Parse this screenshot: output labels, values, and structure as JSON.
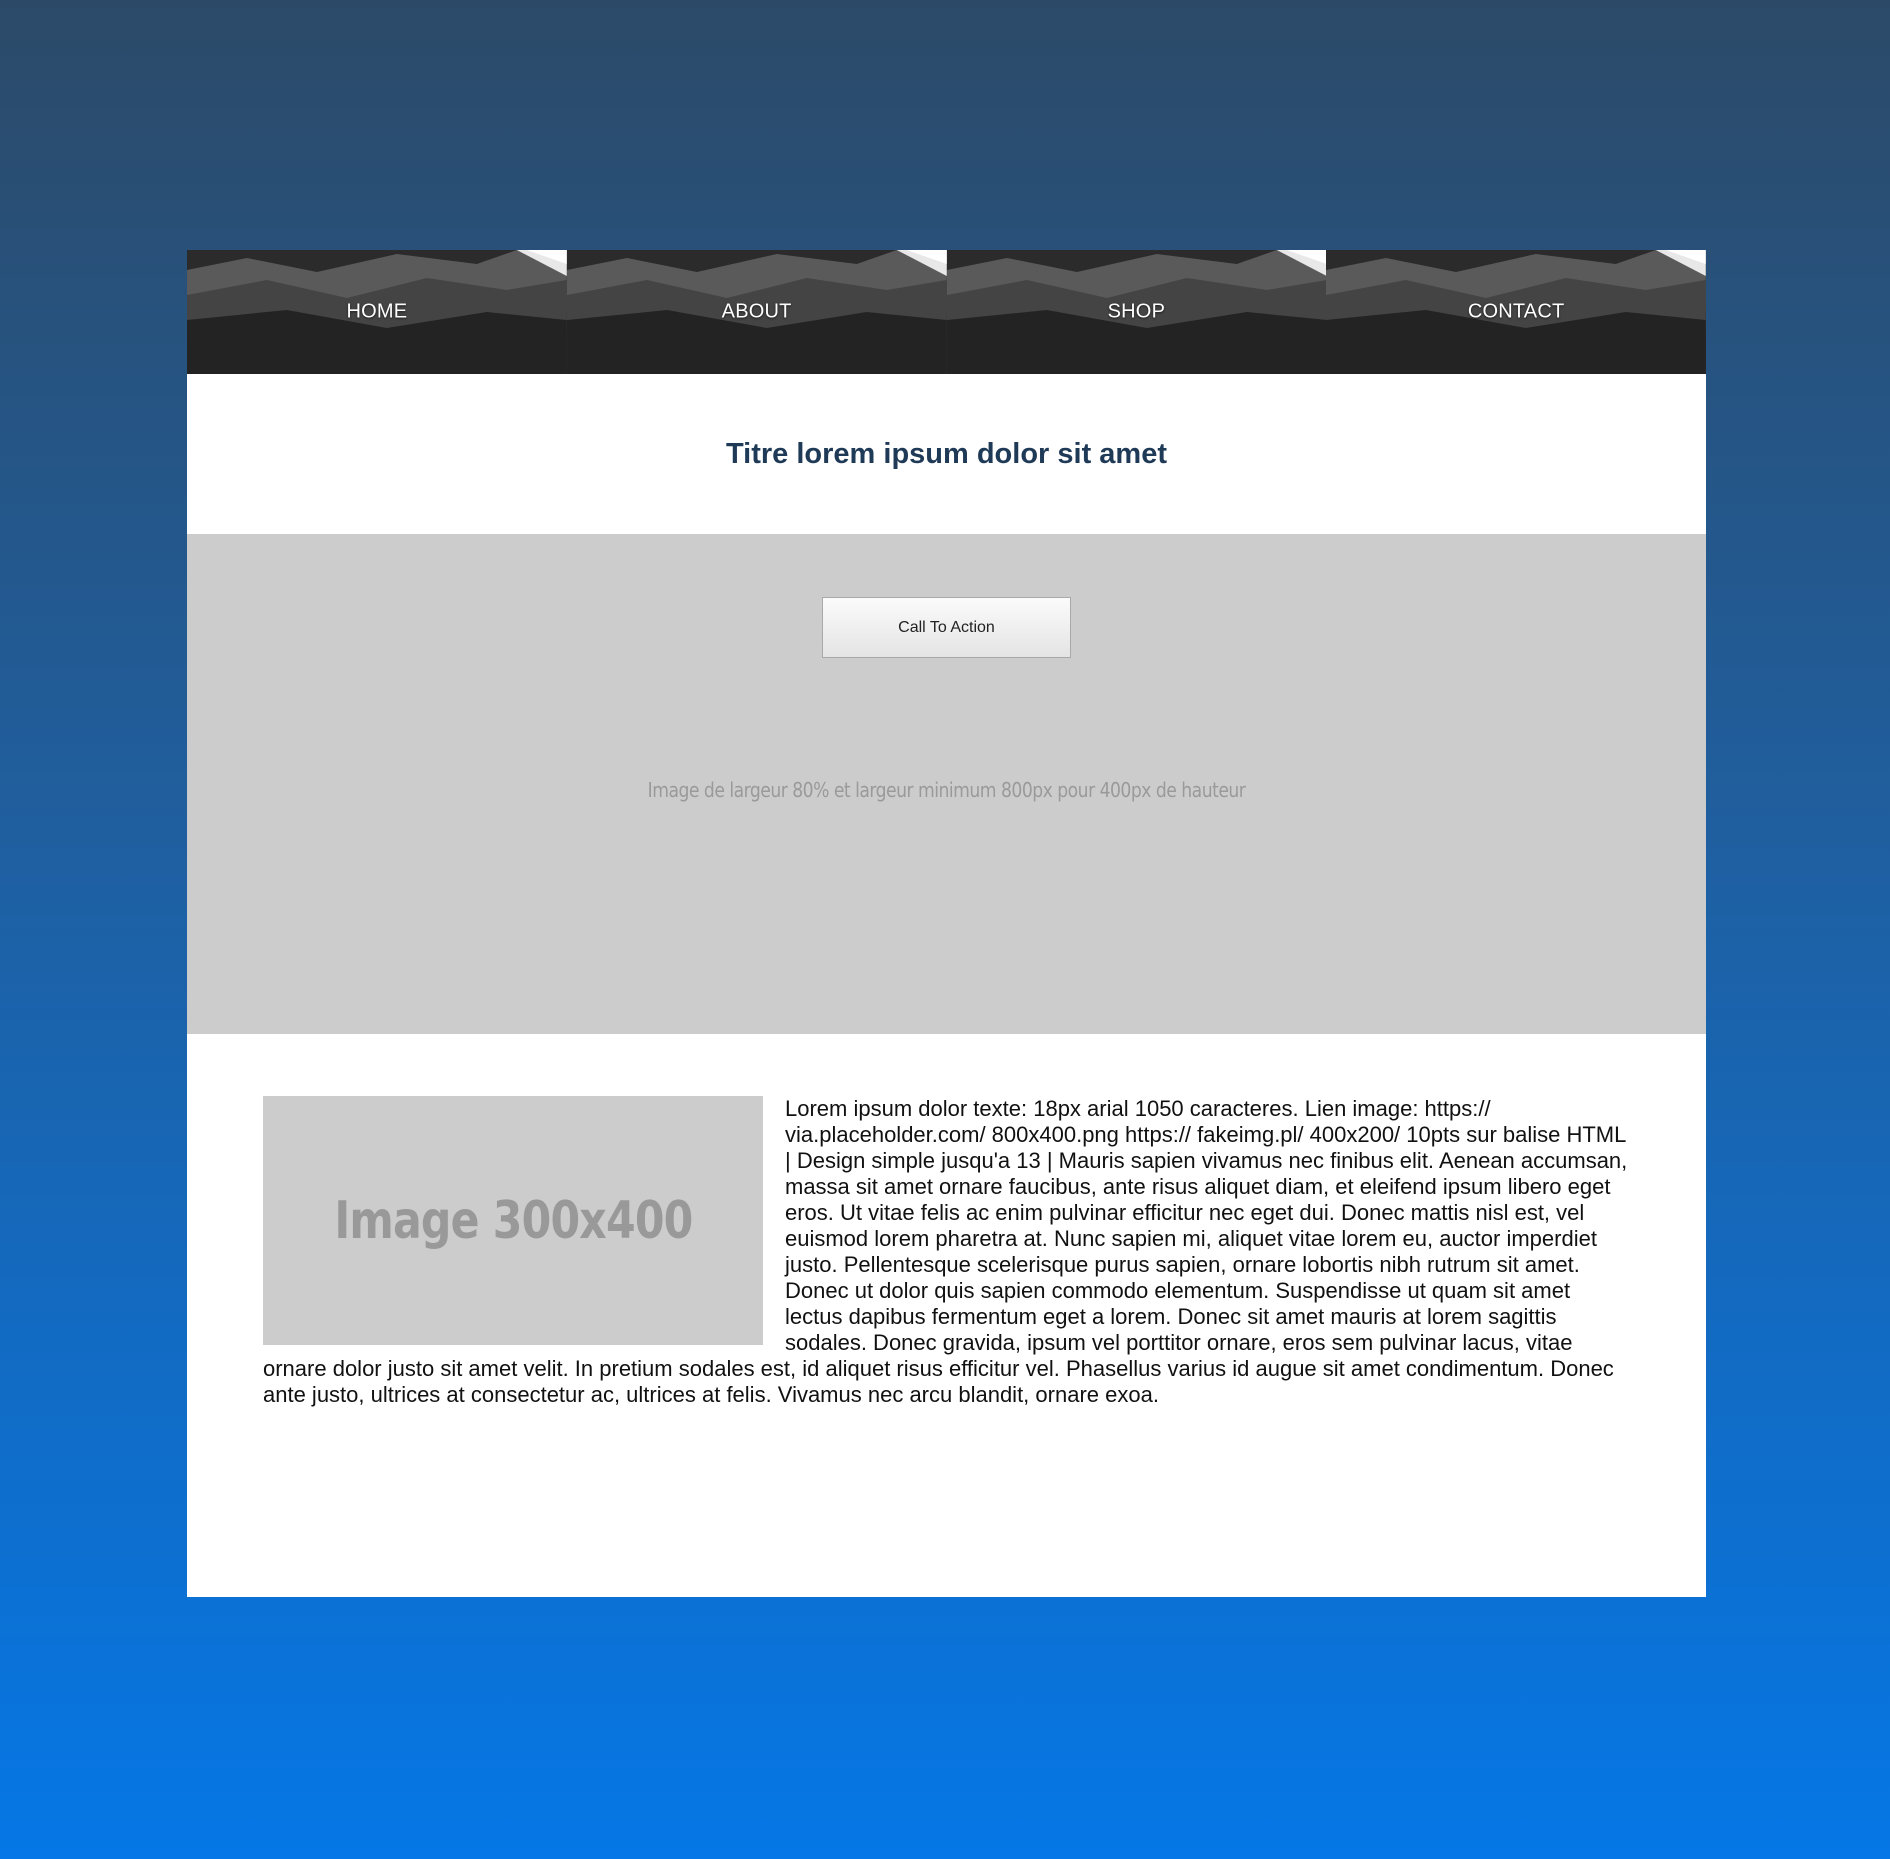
{
  "nav": {
    "items": [
      {
        "label": "HOME"
      },
      {
        "label": "ABOUT"
      },
      {
        "label": "SHOP"
      },
      {
        "label": "CONTACT"
      }
    ]
  },
  "header": {
    "title": "Titre lorem ipsum dolor sit amet"
  },
  "hero": {
    "cta_label": "Call To Action",
    "image_caption": "Image de largeur 80% et largeur minimum 800px pour 400px de hauteur"
  },
  "content": {
    "image_label": "Image 300x400",
    "text": "Lorem ipsum dolor texte: 18px arial 1050 caracteres. Lien image: https:// via.placeholder.com/ 800x400.png https:// fakeimg.pl/ 400x200/ 10pts sur balise HTML | Design simple jusqu'a 13 | Mauris sapien vivamus nec finibus elit. Aenean accumsan, massa sit amet ornare faucibus, ante risus aliquet diam, et eleifend ipsum libero eget eros. Ut vitae felis ac enim pulvinar efficitur nec eget dui. Donec mattis nisl est, vel euismod lorem pharetra at. Nunc sapien mi, aliquet vitae lorem eu, auctor imperdiet justo. Pellentesque scelerisque purus sapien, ornare lobortis nibh rutrum sit amet. Donec ut dolor quis sapien commodo elementum. Suspendisse ut quam sit amet lectus dapibus fermentum eget a lorem. Donec sit amet mauris at lorem sagittis sodales. Donec gravida, ipsum vel porttitor ornare, eros sem pulvinar lacus, vitae ornare dolor justo sit amet velit. In pretium sodales est, id aliquet risus efficitur vel. Phasellus varius id augue sit amet condimentum. Donec ante justo, ultrices at consectetur ac, ultrices at felis. Vivamus nec arcu blandit, ornare exoa."
  },
  "colors": {
    "page_background_top": "#2c4a68",
    "page_background_bottom": "#0577e6",
    "title": "#1f3a57",
    "hero_background": "#cccccc",
    "nav_text": "#ffffff"
  }
}
